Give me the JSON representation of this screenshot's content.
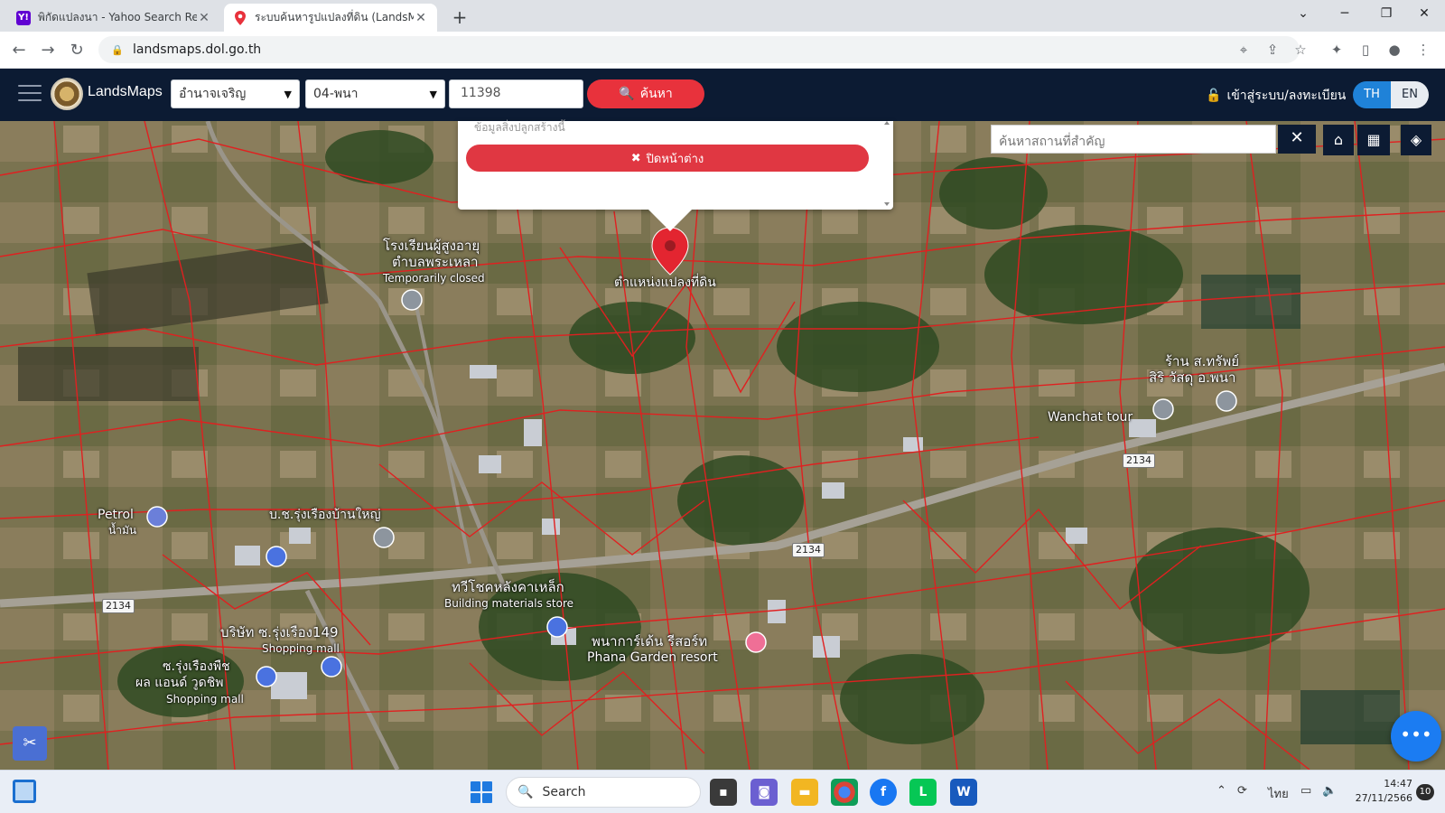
{
  "browser": {
    "tabs": [
      {
        "title": "พิกัดแปลงนา - Yahoo Search Resu",
        "active": false
      },
      {
        "title": "ระบบค้นหารูปแปลงที่ดิน (LandsMap",
        "active": true
      }
    ],
    "address": "landsmaps.dol.go.th"
  },
  "app": {
    "brand": "LandsMaps",
    "district_select": "อำนาจเจริญ",
    "amphoe_select": "04-พนา",
    "parcel_number": "11398",
    "search_button": "ค้นหา",
    "login": "เข้าสู่ระบบ/ลงทะเบียน",
    "lang_th": "TH",
    "lang_en": "EN"
  },
  "popup": {
    "faded_text": "ข้อมูลสิ่งปลูกสร้างนี้",
    "close_button": "ปิดหน้าต่าง"
  },
  "map": {
    "place_search_placeholder": "ค้นหาสถานที่สำคัญ",
    "marker_label": "ตำแหน่งแปลงที่ดิน",
    "labels": {
      "school": "โรงเรียนผู้สูงอายุ",
      "school2": "ตำบลพระเหลา",
      "closed": "Temporarily closed",
      "shop1": "ร้าน ส.ทรัพย์",
      "shop2": "สิริ วัสดุ อ.พนา",
      "wanchat": "Wanchat tour",
      "petrol": "Petrol",
      "petrol2": "น้ำมัน",
      "company": "บ.ช.รุ่งเรืองบ้านใหญ่",
      "steel": "ทวีโชคหลังคาเหล็ก",
      "steel2": "Building materials store",
      "resort": "พนาการ์เด้น รีสอร์ท",
      "resort2": "Phana Garden resort",
      "company149": "บริษัท ซ.รุ่งเรือง149",
      "mall1": "Shopping mall",
      "rp1": "ซ.รุ่งเรืองพืช",
      "rp2": "ผล แอนด์ วูดชิพ",
      "mall2": "Shopping mall"
    },
    "route": "2134"
  },
  "taskbar": {
    "search": "Search",
    "ime": "ไทย",
    "time": "14:47",
    "date": "27/11/2566",
    "notifications": "10"
  },
  "colors": {
    "header": "#0c1b33",
    "accent_red": "#e8323c",
    "accent_blue": "#1f82d8",
    "parcel_line": "#e02020"
  }
}
